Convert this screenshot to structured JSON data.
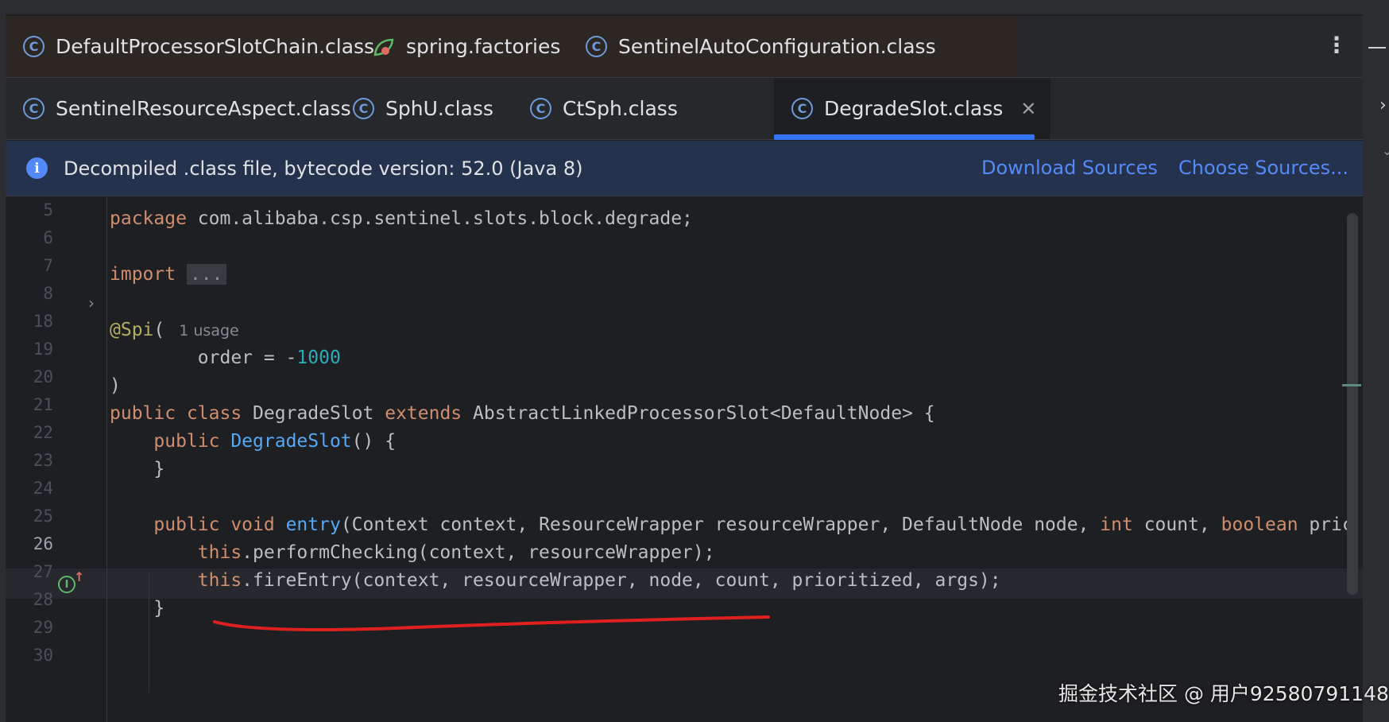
{
  "tabs_row1": [
    {
      "label": "DefaultProcessorSlotChain.class",
      "icon": "class-c-icon"
    },
    {
      "label": "spring.factories",
      "icon": "spring-leaf-icon"
    },
    {
      "label": "SentinelAutoConfiguration.class",
      "icon": "class-c-icon"
    }
  ],
  "tabs_row2": [
    {
      "label": "SentinelResourceAspect.class",
      "icon": "class-c-icon"
    },
    {
      "label": "SphU.class",
      "icon": "class-c-icon"
    },
    {
      "label": "CtSph.class",
      "icon": "class-c-icon"
    },
    {
      "label": "DegradeSlot.class",
      "icon": "class-c-icon",
      "active": true
    }
  ],
  "icons": {
    "class": "C",
    "info": "i",
    "close": "✕",
    "kebab": "⋮",
    "fold": "›",
    "impl": "I",
    "impl_arrow": "↑"
  },
  "banner": {
    "text": "Decompiled .class file, bytecode version: 52.0 (Java 8)",
    "download_sources": "Download Sources",
    "choose_sources": "Choose Sources..."
  },
  "code": {
    "line_numbers": [
      "5",
      "6",
      "7",
      "8",
      "18",
      "19",
      "20",
      "21",
      "22",
      "23",
      "24",
      "25",
      "26",
      "27",
      "28",
      "29",
      "30"
    ],
    "current_line": "26",
    "l6_kw": "package",
    "l6_rest": " com.alibaba.csp.sentinel.slots.block.degrade;",
    "l8_kw": "import",
    "l8_fold": "...",
    "l19_ann": "@Spi",
    "l19_paren": "(",
    "l19_hint": "1 usage",
    "l20_a": "        order = -",
    "l20_num": "1000",
    "l21": ")",
    "l22_kw1": "public",
    "l22_kw2": "class",
    "l22_name": " DegradeSlot ",
    "l22_kw3": "extends",
    "l22_rest": " AbstractLinkedProcessorSlot<DefaultNode> {",
    "l23_kw": "    public ",
    "l23_fn": "DegradeSlot",
    "l23_rest": "() {",
    "l24": "    }",
    "l26_kw1": "    public ",
    "l26_kw2": "void ",
    "l26_fn": "entry",
    "l26_a": "(Context context, ResourceWrapper resourceWrapper, DefaultNode node, ",
    "l26_int": "int",
    "l26_b": " count, ",
    "l26_bool": "boolean",
    "l26_c": " pric",
    "l27_kw": "        this",
    "l27_rest": ".performChecking(context, resourceWrapper);",
    "l28_kw": "        this",
    "l28_rest": ".fireEntry(context, resourceWrapper, node, count, prioritized, args);",
    "l29": "    }"
  },
  "watermark": "掘金技术社区 @ 用户92580791148",
  "colors": {
    "accent": "#3574f0",
    "keyword": "#cf8e6d",
    "function": "#56a8f5",
    "number": "#2aacb8",
    "annotation": "#b3ae60",
    "red_underline": "#e0201f"
  }
}
